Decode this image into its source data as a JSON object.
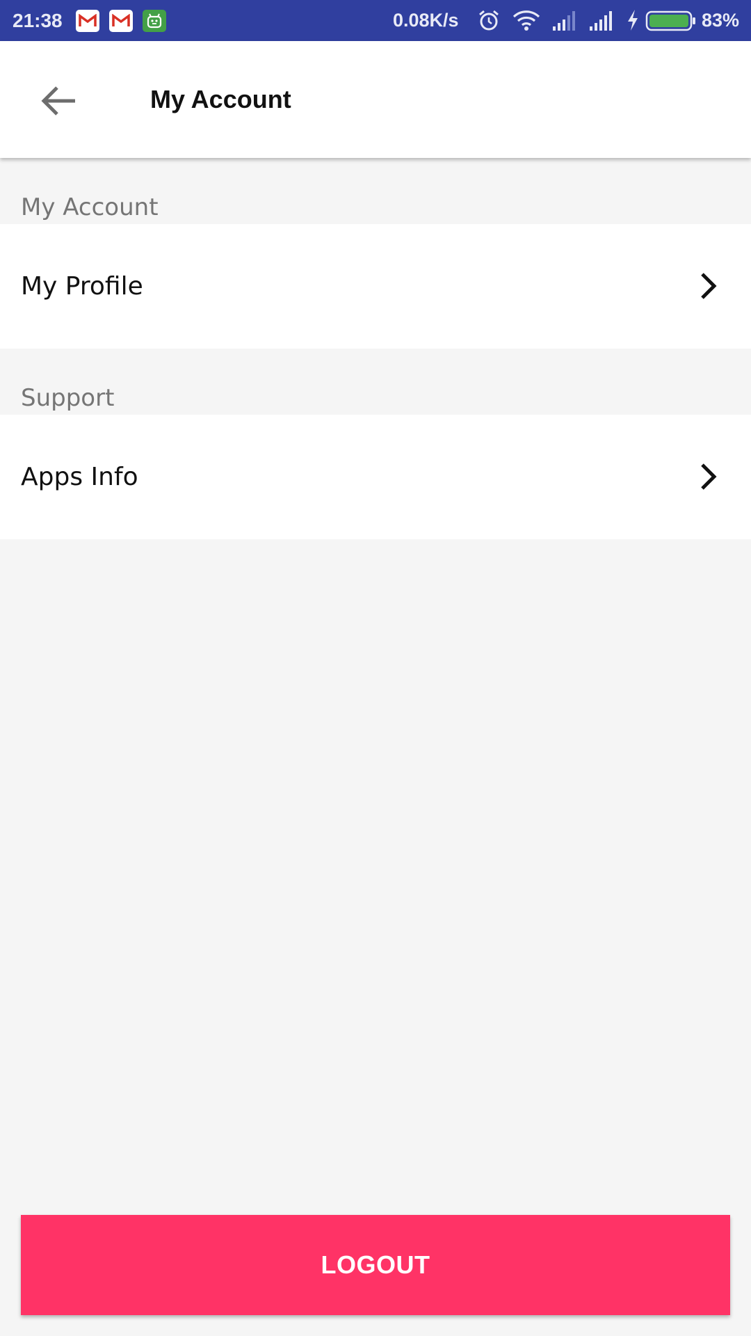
{
  "status_bar": {
    "time": "21:38",
    "network_speed": "0.08K/s",
    "battery_percent": "83%",
    "battery_level": 0.83,
    "notification_icons": [
      "gmail-icon",
      "gmail-icon",
      "android-app-icon"
    ],
    "system_icons": [
      "alarm-icon",
      "wifi-icon",
      "signal-icon",
      "signal-icon",
      "charging-icon",
      "battery-icon"
    ],
    "colors": {
      "background": "#303f9f",
      "battery_fill": "#4caf50"
    }
  },
  "app_bar": {
    "title": "My Account",
    "back_icon": "arrow-back-icon"
  },
  "sections": [
    {
      "header": "My Account",
      "items": [
        {
          "label": "My Profile",
          "icon": "chevron-right-icon"
        }
      ]
    },
    {
      "header": "Support",
      "items": [
        {
          "label": "Apps Info",
          "icon": "chevron-right-icon"
        }
      ]
    }
  ],
  "logout": {
    "label": "LOGOUT",
    "color": "#ff3366"
  }
}
